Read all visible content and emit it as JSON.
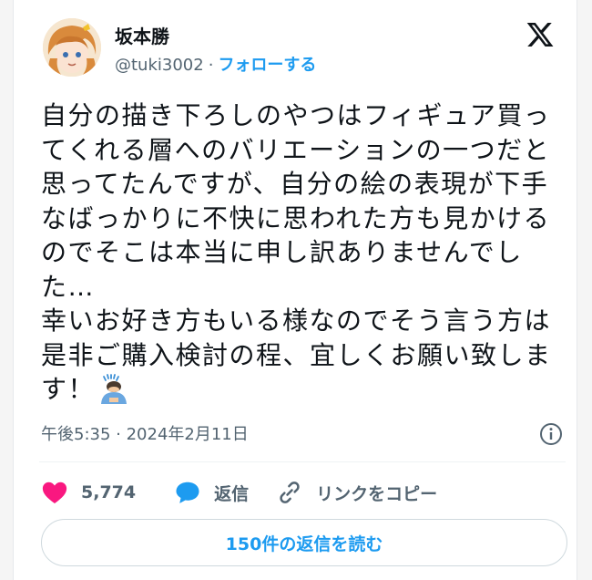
{
  "author": {
    "name": "坂本勝",
    "handle": "@tuki3002",
    "separator": "·",
    "follow_label": "フォローする"
  },
  "tweet": {
    "text": "自分の描き下ろしのやつはフィギュア買ってくれる層へのバリエーションの一つだと思ってたんですが、自分の絵の表現が下手なばっかりに不快に思われた方も見かけるのでそこは本当に申し訳ありませんでした…\n幸いお好き方もいる様なのでそう言う方は是非ご購入検討の程、宜しくお願い致します！",
    "emoji": "person-bowing-emoji",
    "timestamp": "午後5:35 · 2024年2月11日"
  },
  "actions": {
    "like_count": "5,774",
    "reply_label": "返信",
    "copy_link_label": "リンクをコピー"
  },
  "read_replies_label": "150件の返信を読む",
  "colors": {
    "accent": "#1d9bf0",
    "like": "#f91880",
    "muted": "#536471",
    "text": "#0f1419"
  }
}
